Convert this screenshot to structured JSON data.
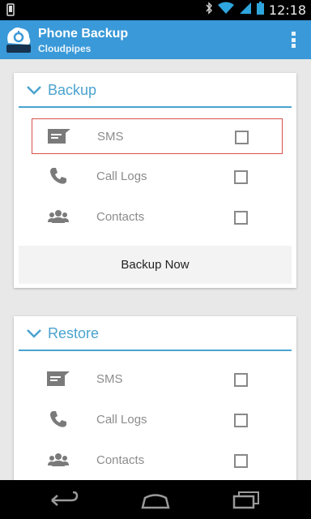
{
  "status_bar": {
    "time": "12:18",
    "icons": [
      "android-notification-icon",
      "bluetooth-icon",
      "wifi-icon",
      "signal-icon",
      "battery-icon"
    ]
  },
  "app_bar": {
    "title": "Phone Backup",
    "subtitle": "Cloudpipes",
    "accent_color": "#3a99d8"
  },
  "backup": {
    "header": "Backup",
    "items": [
      {
        "label": "SMS",
        "icon": "sms-icon",
        "checked": false,
        "selected": true
      },
      {
        "label": "Call Logs",
        "icon": "phone-icon",
        "checked": false,
        "selected": false
      },
      {
        "label": "Contacts",
        "icon": "contacts-icon",
        "checked": false,
        "selected": false
      }
    ],
    "action_label": "Backup Now"
  },
  "restore": {
    "header": "Restore",
    "items": [
      {
        "label": "SMS",
        "icon": "sms-icon",
        "checked": false
      },
      {
        "label": "Call Logs",
        "icon": "phone-icon",
        "checked": false
      },
      {
        "label": "Contacts",
        "icon": "contacts-icon",
        "checked": false
      }
    ]
  },
  "nav_bar": {
    "buttons": [
      "back-icon",
      "home-icon",
      "recent-apps-icon"
    ]
  }
}
